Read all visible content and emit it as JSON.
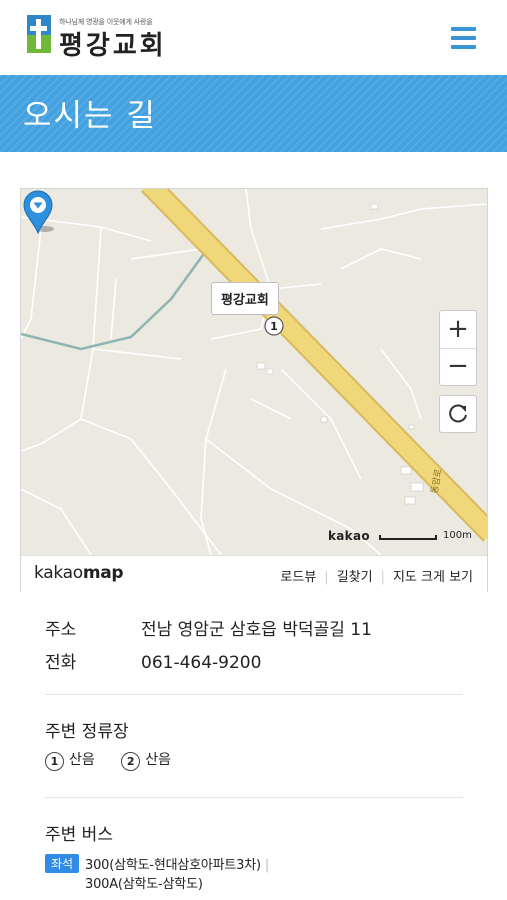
{
  "header": {
    "tagline": "하나님께 영광을 이웃에게 사랑을",
    "site_name": "평강교회",
    "menu_icon": "hamburger-menu-icon"
  },
  "banner": {
    "title": "오시는 길"
  },
  "map": {
    "place_label": "평강교회",
    "route_badge": "1",
    "road_label": "동암로",
    "zoom_in": "+",
    "zoom_out": "−",
    "refresh_icon": "refresh-icon",
    "watermark": "kakao",
    "scale": "100m",
    "brand_light": "kakao",
    "brand_bold": "map",
    "links": [
      "로드뷰",
      "길찾기",
      "지도 크게 보기"
    ]
  },
  "info": {
    "address_label": "주소",
    "address": "전남 영암군 삼호읍 박덕골길 11",
    "phone_label": "전화",
    "phone": "061-464-9200"
  },
  "stops": {
    "title": "주변 정류장",
    "items": [
      {
        "num": "1",
        "name": "산음"
      },
      {
        "num": "2",
        "name": "산음"
      }
    ]
  },
  "bus": {
    "title": "주변 버스",
    "badge": "좌석",
    "lines": [
      "300(삼학도-현대삼호아파트3차)",
      "300A(삼학도-삼학도)"
    ]
  },
  "colors": {
    "accent": "#43a1e0",
    "bus_badge": "#2f8be6",
    "marker": "#2e8fdc",
    "road": "#f0d87a"
  }
}
